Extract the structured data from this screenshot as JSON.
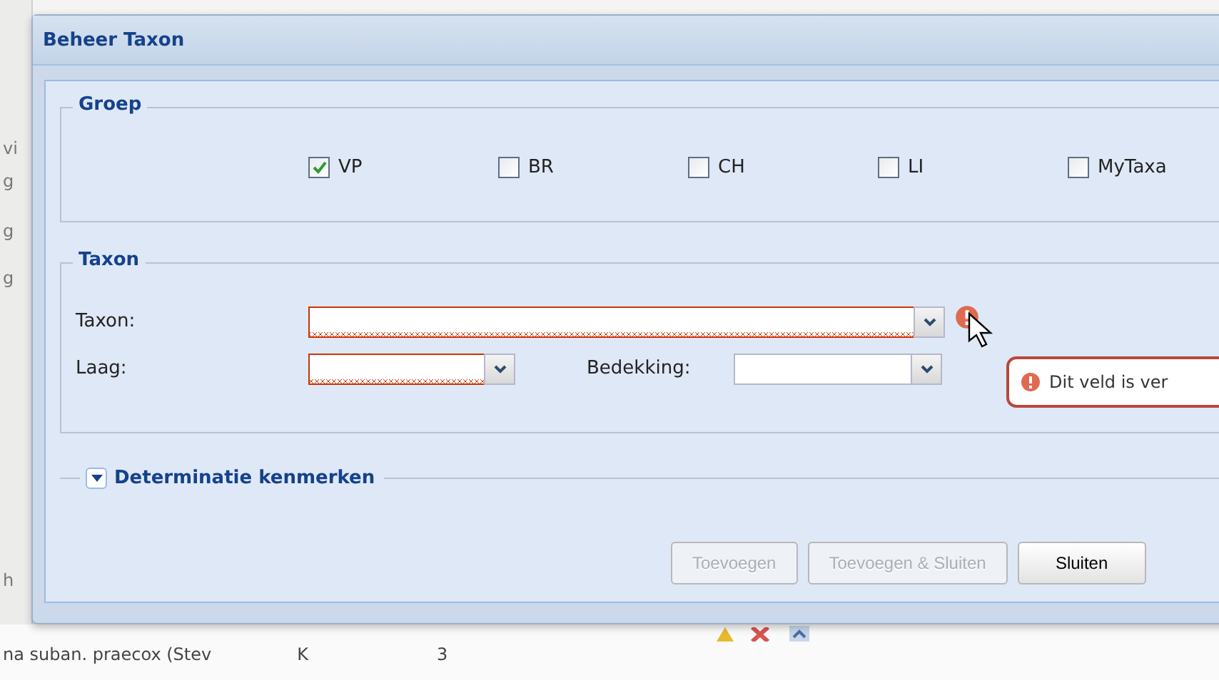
{
  "window": {
    "title": "Beheer Taxon"
  },
  "groep": {
    "legend": "Groep",
    "options": [
      {
        "label": "VP",
        "checked": true
      },
      {
        "label": "BR",
        "checked": false
      },
      {
        "label": "CH",
        "checked": false
      },
      {
        "label": "LI",
        "checked": false
      },
      {
        "label": "MyTaxa",
        "checked": false
      }
    ]
  },
  "taxon": {
    "legend": "Taxon",
    "rows": [
      [
        {
          "label": "Taxon:",
          "invalid": true
        }
      ],
      [
        {
          "label": "Laag:",
          "invalid": true
        },
        {
          "label": "Bedekking:",
          "invalid": false
        }
      ]
    ]
  },
  "error": {
    "message": "Dit veld is ver"
  },
  "determinatie": {
    "label": "Determinatie kenmerken",
    "expanded": false
  },
  "buttons": [
    {
      "label": "Toevoegen",
      "disabled": true
    },
    {
      "label": "Toevoegen & Sluiten",
      "disabled": true
    },
    {
      "label": "Sluiten",
      "disabled": false
    }
  ],
  "background": {
    "left_fragments": [
      "vi",
      "g",
      "g",
      "g",
      "h"
    ],
    "row": [
      "na suban. praecox (Stev",
      "K",
      "3"
    ]
  }
}
